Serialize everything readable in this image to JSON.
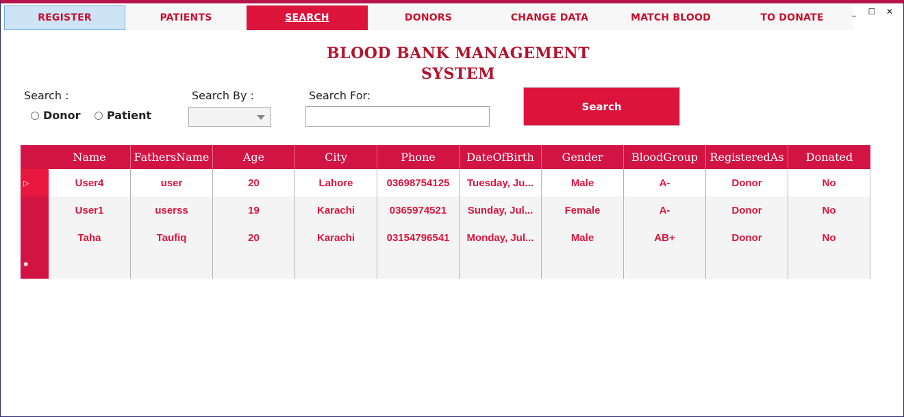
{
  "tabs": [
    {
      "label": "REGISTER"
    },
    {
      "label": "PATIENTS"
    },
    {
      "label": "SEARCH"
    },
    {
      "label": "DONORS"
    },
    {
      "label": "CHANGE DATA"
    },
    {
      "label": "MATCH BLOOD"
    },
    {
      "label": "TO DONATE"
    }
  ],
  "active_tab": "SEARCH",
  "window_controls": {
    "minimize": "_",
    "maximize": "☐",
    "close": "✕"
  },
  "title": {
    "line1": "BLOOD BANK MANAGEMENT",
    "line2": "SYSTEM"
  },
  "search": {
    "search_label": "Search  :",
    "radio_donor": "Donor",
    "radio_patient": "Patient",
    "search_by_label": "Search  By :",
    "search_by_value": "",
    "search_for_label": "Search  For:",
    "search_for_value": "",
    "button_label": "Search"
  },
  "grid": {
    "columns": [
      "Name",
      "FathersName",
      "Age",
      "City",
      "Phone",
      "DateOfBirth",
      "Gender",
      "BloodGroup",
      "RegisteredAs",
      "Donated"
    ],
    "rows": [
      [
        "User4",
        "user",
        "20",
        "Lahore",
        "03698754125",
        "Tuesday, Ju...",
        "Male",
        "A-",
        "Donor",
        "No"
      ],
      [
        "User1",
        "userss",
        "19",
        "Karachi",
        "0365974521",
        "Sunday, Jul...",
        "Female",
        "A-",
        "Donor",
        "No"
      ],
      [
        "Taha",
        "Taufiq",
        "20",
        "Karachi",
        "03154796541",
        "Monday, Jul...",
        "Male",
        "AB+",
        "Donor",
        "No"
      ]
    ],
    "current_row_glyph": "▷",
    "new_row_glyph": "✱"
  },
  "colors": {
    "accent": "#dc143c",
    "header_bg": "#d21444",
    "title": "#b3122c",
    "selected_tab_border": "#6ea6d8"
  }
}
